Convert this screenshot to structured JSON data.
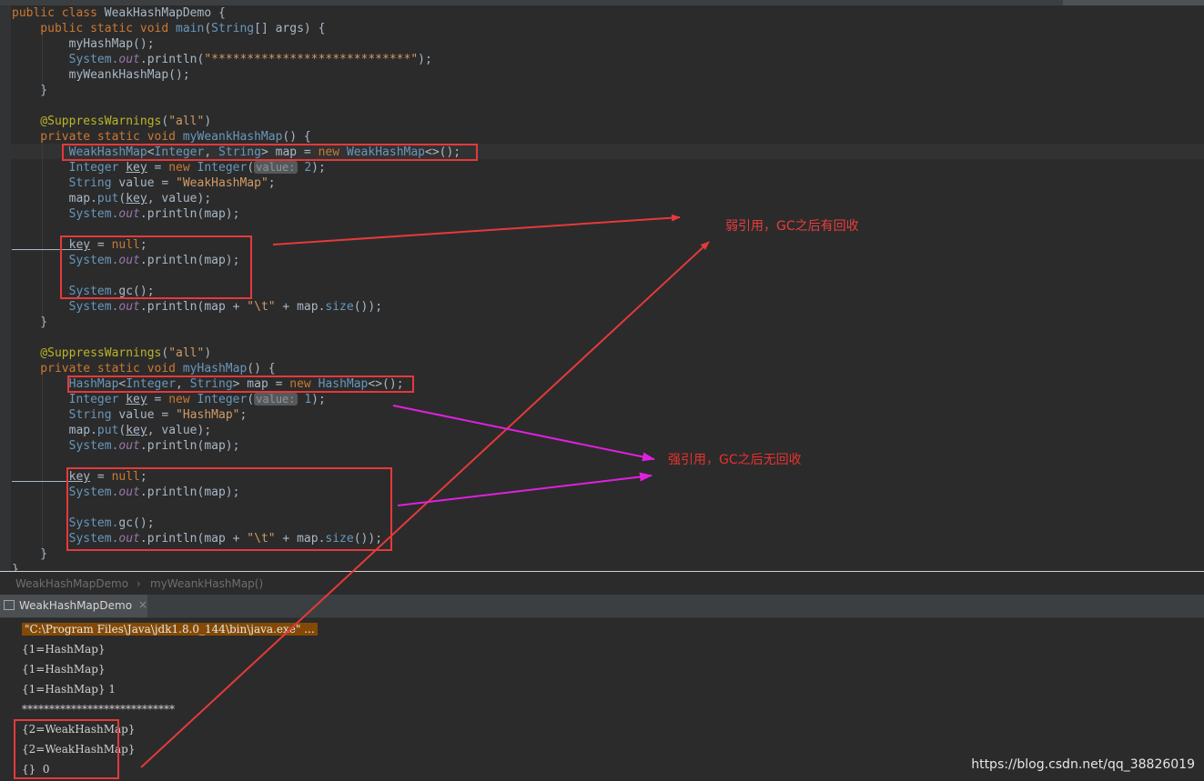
{
  "editor": {
    "lines": [
      [
        {
          "c": "kw",
          "t": "public class "
        },
        {
          "c": "",
          "t": "WeakHashMapDemo {"
        }
      ],
      [
        {
          "c": "kw",
          "t": "    public static void "
        },
        {
          "c": "ty",
          "t": "main"
        },
        {
          "c": "",
          "t": "("
        },
        {
          "c": "ty",
          "t": "String"
        },
        {
          "c": "",
          "t": "[] args) {"
        }
      ],
      [
        {
          "c": "",
          "t": "        myHashMap();"
        }
      ],
      [
        {
          "c": "ty",
          "t": "        System."
        },
        {
          "c": "fld",
          "t": "out"
        },
        {
          "c": "",
          "t": ".println("
        },
        {
          "c": "str2",
          "t": "\"****************************\""
        },
        {
          "c": "",
          "t": ");"
        }
      ],
      [
        {
          "c": "",
          "t": "        myWeankHashMap();"
        }
      ],
      [
        {
          "c": "",
          "t": "    }"
        }
      ],
      [],
      [
        {
          "c": "ann",
          "t": "    @SuppressWarnings"
        },
        {
          "c": "",
          "t": "("
        },
        {
          "c": "str2",
          "t": "\"all\""
        },
        {
          "c": "",
          "t": ")"
        }
      ],
      [
        {
          "c": "kw",
          "t": "    private static void "
        },
        {
          "c": "ty",
          "t": "myWeankHashMap"
        },
        {
          "c": "",
          "t": "() {"
        }
      ],
      [
        {
          "c": "ty",
          "t": "        WeakHashMap"
        },
        {
          "c": "",
          "t": "<"
        },
        {
          "c": "ty",
          "t": "Integer"
        },
        {
          "c": "",
          "t": ", "
        },
        {
          "c": "ty",
          "t": "String"
        },
        {
          "c": "",
          "t": "> map = "
        },
        {
          "c": "kw",
          "t": "new "
        },
        {
          "c": "ty",
          "t": "WeakHashMap"
        },
        {
          "c": "",
          "t": "<>();"
        }
      ],
      [
        {
          "c": "ty",
          "t": "        Integer "
        },
        {
          "c": "ul",
          "t": "key"
        },
        {
          "c": "",
          "t": " = "
        },
        {
          "c": "kw",
          "t": "new "
        },
        {
          "c": "ty",
          "t": "Integer"
        },
        {
          "c": "",
          "t": "("
        },
        {
          "c": "hint",
          "t": "value:"
        },
        {
          "c": "num",
          "t": " 2"
        },
        {
          "c": "",
          "t": ");"
        }
      ],
      [
        {
          "c": "ty",
          "t": "        String "
        },
        {
          "c": "",
          "t": "value = "
        },
        {
          "c": "str2",
          "t": "\"WeakHashMap\""
        },
        {
          "c": "",
          "t": ";"
        }
      ],
      [
        {
          "c": "",
          "t": "        map."
        },
        {
          "c": "ty",
          "t": "put"
        },
        {
          "c": "",
          "t": "("
        },
        {
          "c": "ul",
          "t": "key"
        },
        {
          "c": "",
          "t": ", value);"
        }
      ],
      [
        {
          "c": "ty",
          "t": "        System."
        },
        {
          "c": "fld",
          "t": "out"
        },
        {
          "c": "",
          "t": ".println(map);"
        }
      ],
      [],
      [
        {
          "c": "ul",
          "t": "        key"
        },
        {
          "c": "",
          "t": " = "
        },
        {
          "c": "kw",
          "t": "null"
        },
        {
          "c": "",
          "t": ";"
        }
      ],
      [
        {
          "c": "ty",
          "t": "        System."
        },
        {
          "c": "fld",
          "t": "out"
        },
        {
          "c": "",
          "t": ".println(map);"
        }
      ],
      [],
      [
        {
          "c": "ty",
          "t": "        System."
        },
        {
          "c": "",
          "t": "gc();"
        }
      ],
      [
        {
          "c": "ty",
          "t": "        System."
        },
        {
          "c": "fld",
          "t": "out"
        },
        {
          "c": "",
          "t": ".println(map + "
        },
        {
          "c": "str2",
          "t": "\"\\t\""
        },
        {
          "c": "",
          "t": " + map."
        },
        {
          "c": "ty",
          "t": "size"
        },
        {
          "c": "",
          "t": "());"
        }
      ],
      [
        {
          "c": "",
          "t": "    }"
        }
      ],
      [],
      [
        {
          "c": "ann",
          "t": "    @SuppressWarnings"
        },
        {
          "c": "",
          "t": "("
        },
        {
          "c": "str2",
          "t": "\"all\""
        },
        {
          "c": "",
          "t": ")"
        }
      ],
      [
        {
          "c": "kw",
          "t": "    private static void "
        },
        {
          "c": "ty",
          "t": "myHashMap"
        },
        {
          "c": "",
          "t": "() {"
        }
      ],
      [
        {
          "c": "ty",
          "t": "        HashMap"
        },
        {
          "c": "",
          "t": "<"
        },
        {
          "c": "ty",
          "t": "Integer"
        },
        {
          "c": "",
          "t": ", "
        },
        {
          "c": "ty",
          "t": "String"
        },
        {
          "c": "",
          "t": "> map = "
        },
        {
          "c": "kw",
          "t": "new "
        },
        {
          "c": "ty",
          "t": "HashMap"
        },
        {
          "c": "",
          "t": "<>();"
        }
      ],
      [
        {
          "c": "ty",
          "t": "        Integer "
        },
        {
          "c": "ul",
          "t": "key"
        },
        {
          "c": "",
          "t": " = "
        },
        {
          "c": "kw",
          "t": "new "
        },
        {
          "c": "ty",
          "t": "Integer"
        },
        {
          "c": "",
          "t": "("
        },
        {
          "c": "hint",
          "t": "value:"
        },
        {
          "c": "num",
          "t": " 1"
        },
        {
          "c": "",
          "t": ");"
        }
      ],
      [
        {
          "c": "ty",
          "t": "        String "
        },
        {
          "c": "",
          "t": "value = "
        },
        {
          "c": "str2",
          "t": "\"HashMap\""
        },
        {
          "c": "",
          "t": ";"
        }
      ],
      [
        {
          "c": "",
          "t": "        map."
        },
        {
          "c": "ty",
          "t": "put"
        },
        {
          "c": "",
          "t": "("
        },
        {
          "c": "ul",
          "t": "key"
        },
        {
          "c": "",
          "t": ", value);"
        }
      ],
      [
        {
          "c": "ty",
          "t": "        System."
        },
        {
          "c": "fld",
          "t": "out"
        },
        {
          "c": "",
          "t": ".println(map);"
        }
      ],
      [],
      [
        {
          "c": "ul",
          "t": "        key"
        },
        {
          "c": "",
          "t": " = "
        },
        {
          "c": "kw",
          "t": "null"
        },
        {
          "c": "",
          "t": ";"
        }
      ],
      [
        {
          "c": "ty",
          "t": "        System."
        },
        {
          "c": "fld",
          "t": "out"
        },
        {
          "c": "",
          "t": ".println(map);"
        }
      ],
      [],
      [
        {
          "c": "ty",
          "t": "        System."
        },
        {
          "c": "",
          "t": "gc();"
        }
      ],
      [
        {
          "c": "ty",
          "t": "        System."
        },
        {
          "c": "fld",
          "t": "out"
        },
        {
          "c": "",
          "t": ".println(map + "
        },
        {
          "c": "str2",
          "t": "\"\\t\""
        },
        {
          "c": "",
          "t": " + map."
        },
        {
          "c": "ty",
          "t": "size"
        },
        {
          "c": "",
          "t": "());"
        }
      ],
      [
        {
          "c": "",
          "t": "    }"
        }
      ],
      [
        {
          "c": "",
          "t": "}"
        }
      ]
    ]
  },
  "breadcrumb": {
    "class_name": "WeakHashMapDemo",
    "separator": "›",
    "method_name": "myWeankHashMap()"
  },
  "run_panel": {
    "tab_label": "WeakHashMapDemo",
    "tab_icon": "console-icon",
    "close_glyph": "×",
    "lines": [
      "\"C:\\Program Files\\Java\\jdk1.8.0_144\\bin\\java.exe\" ...",
      "{1=HashMap}",
      "{1=HashMap}",
      "{1=HashMap} 1",
      "****************************",
      "{2=WeakHashMap}",
      "{2=WeakHashMap}",
      "{}  0"
    ]
  },
  "annotations": {
    "weak_note": "弱引用，GC之后有回收",
    "strong_note": "强引用，GC之后无回收",
    "arrow_red": "#e5393b",
    "arrow_magenta": "#e020e0"
  },
  "watermark": "https://blog.csdn.net/qq_38826019"
}
